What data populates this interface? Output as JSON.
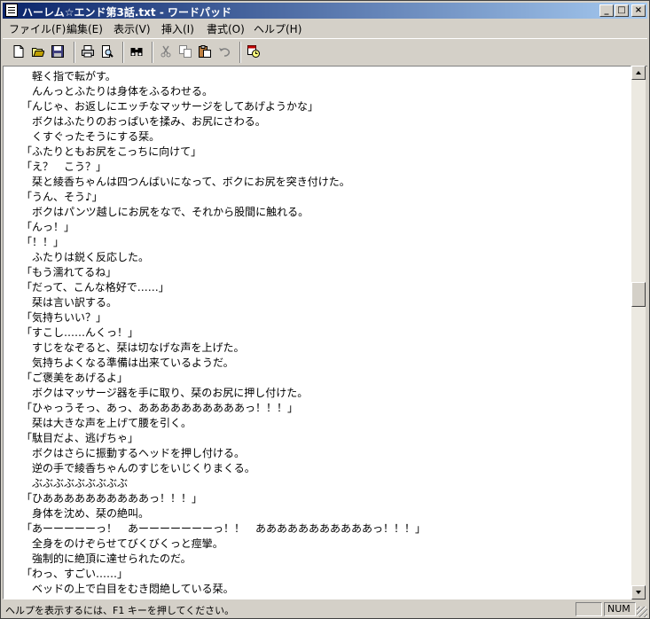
{
  "window": {
    "title": "ハーレム☆エンド第3話.txt - ワードパッド",
    "caption_buttons": {
      "minimize": "_",
      "maximize": "□",
      "close": "×"
    }
  },
  "menu": [
    "ファイル(F)",
    "編集(E)",
    "表示(V)",
    "挿入(I)",
    "書式(O)",
    "ヘルプ(H)"
  ],
  "toolbar": {
    "icons": [
      "new-document-icon",
      "open-folder-icon",
      "save-disk-icon",
      "print-icon",
      "print-preview-icon",
      "find-binoculars-icon",
      "cut-scissors-icon",
      "copy-icon",
      "paste-icon",
      "undo-icon",
      "insert-datetime-icon"
    ]
  },
  "document": {
    "lines": [
      "　軽く指で転がす。",
      "　んんっとふたりは身体をふるわせる。",
      "「んじゃ、お返しにエッチなマッサージをしてあげようかな」",
      "　ボクはふたりのおっぱいを揉み、お尻にさわる。",
      "　くすぐったそうにする栞。",
      "「ふたりともお尻をこっちに向けて」",
      "「え？　こう？」",
      "　栞と綾香ちゃんは四つんばいになって、ボクにお尻を突き付けた。",
      "「うん、そう♪」",
      "　ボクはパンツ越しにお尻をなで、それから股間に触れる。",
      "「んっ！」",
      "「！！」",
      "　ふたりは鋭く反応した。",
      "「もう濡れてるね」",
      "「だって、こんな格好で……」",
      "　栞は言い訳する。",
      "「気持ちいい？」",
      "「すこし……んくっ！」",
      "　すじをなぞると、栞は切なげな声を上げた。",
      "　気持ちよくなる準備は出来ているようだ。",
      "「ご褒美をあげるよ」",
      "　ボクはマッサージ器を手に取り、栞のお尻に押し付けた。",
      "「ひゃっうそっ、あっ、ああああああああああっ！！！」",
      "　栞は大きな声を上げて腰を引く。",
      "「駄目だよ、逃げちゃ」",
      "　ボクはさらに振動するヘッドを押し付ける。",
      "　逆の手で綾香ちゃんのすじをいじくりまくる。",
      "　ぶぶぶぶぶぶぶぶぶ",
      "「ひああああああああああっ！！！」",
      "　身体を沈め、栞の絶叫。",
      "「あーーーーーっ！　あーーーーーーーっ！！　あああああああああああっ！！！」",
      "　全身をのけぞらせてびくびくっと痙攣。",
      "　強制的に絶頂に達せられたのだ。",
      "「わっ、すごい……」",
      "　ベッドの上で白目をむき悶絶している栞。"
    ]
  },
  "scrollbar": {
    "position_fraction": 0.42
  },
  "status": {
    "help_text": "ヘルプを表示するには、F1 キーを押してください。",
    "num": "NUM"
  }
}
